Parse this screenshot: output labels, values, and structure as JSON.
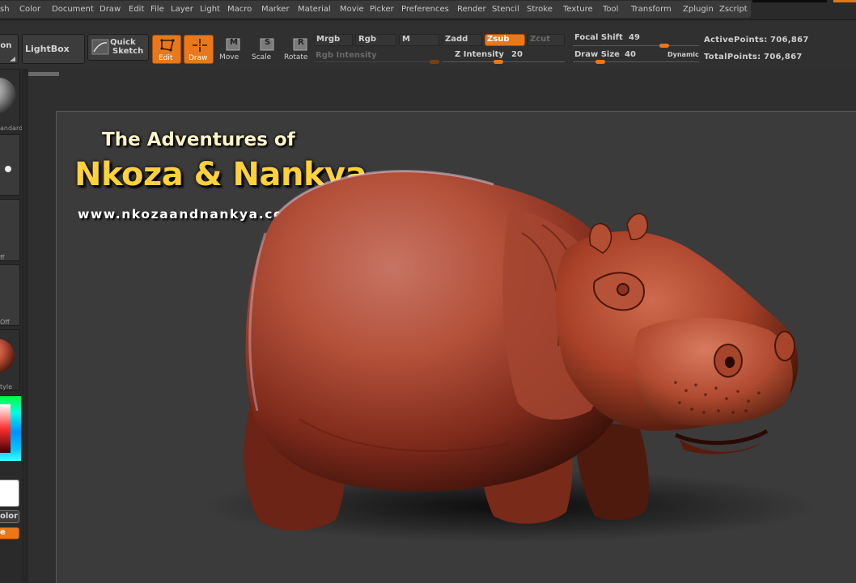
{
  "menubar": {
    "items": [
      "sh",
      "Color",
      "Document",
      "Draw",
      "Edit",
      "File",
      "Layer",
      "Light",
      "Macro",
      "Marker",
      "Material",
      "Movie",
      "Picker",
      "Preferences",
      "Render",
      "Stencil",
      "Stroke",
      "Texture",
      "Tool",
      "Transform",
      "Zplugin",
      "Zscript"
    ]
  },
  "toolbar": {
    "projection_label": "ion",
    "lightbox_label": "LightBox",
    "quick_sketch_label_1": "Quick",
    "quick_sketch_label_2": "Sketch",
    "edit_label": "Edit",
    "draw_label": "Draw",
    "move_label": "Move",
    "move_key": "M",
    "scale_label": "Scale",
    "scale_key": "S",
    "rotate_label": "Rotate",
    "rotate_key": "R",
    "mrgb_label": "Mrgb",
    "rgb_label": "Rgb",
    "m_label": "M",
    "rgb_intensity_label": "Rgb  Intensity",
    "zadd_label": "Zadd",
    "zsub_label": "Zsub",
    "zcut_label": "Zcut",
    "z_intensity_label": "Z  Intensity",
    "z_intensity_value": "20",
    "focal_shift_label": "Focal  Shift",
    "focal_shift_value": "49",
    "draw_size_label": "Draw  Size",
    "draw_size_value": "40",
    "dynamic_label": "Dynamic",
    "active_points_label": "ActivePoints:",
    "active_points_value": "706,867",
    "total_points_label": "TotalPoints:",
    "total_points_value": "706,867"
  },
  "left_tray": {
    "standard_caption": "andard",
    "off_caption_1": "ff",
    "off_caption_2": "Off",
    "style_caption": "tyle",
    "color_label": "olor",
    "orange_label": "e"
  },
  "document": {
    "title_line_1": "The Adventures of",
    "title_line_2": "Nkoza & Nankya",
    "url": "www.nkozaandnankya.com"
  },
  "colors": {
    "accent": "#e8781a",
    "title_gold": "#ffd13a",
    "sculpt_red": "#b24a32"
  }
}
